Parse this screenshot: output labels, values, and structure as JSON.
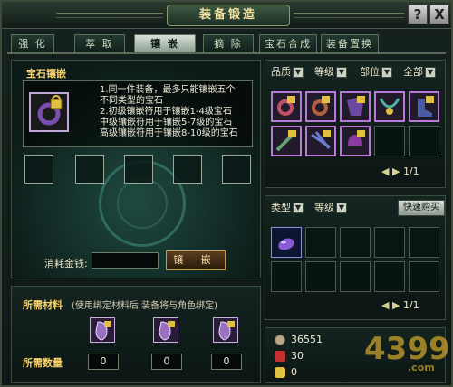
{
  "window": {
    "title": "装备锻造"
  },
  "buttons": {
    "help": "?",
    "close": "X"
  },
  "tabs": [
    "强 化",
    "萃 取",
    "镶 嵌",
    "摘 除",
    "宝石合成",
    "装备置换"
  ],
  "active_tab": 2,
  "inlay": {
    "section_title": "宝石镶嵌",
    "lines": [
      "1.同一件装备，最多只能镶嵌五个",
      "不同类型的宝石",
      "2.初级镶嵌符用于镶嵌1-4级宝石",
      "中级镶嵌符用于镶嵌5-7级的宝石",
      "高级镶嵌符用于镶嵌8-10级的宝石"
    ],
    "cost_label": "消耗金钱:",
    "cost_value": "",
    "inlay_button": "镶 嵌"
  },
  "materials": {
    "title": "所需材料",
    "note": "(使用绑定材料后,装备将与角色绑定)",
    "qty_label": "所需数量",
    "quantities": [
      "0",
      "0",
      "0"
    ]
  },
  "inventory": {
    "filters": [
      "品质",
      "等级",
      "部位",
      "全部"
    ],
    "page": "1/1"
  },
  "gems": {
    "filters": [
      "类型",
      "等级"
    ],
    "buy_button": "快速购买",
    "page": "1/1"
  },
  "currency": {
    "gold": "36551",
    "bound_gold": "30",
    "ingot": "0",
    "gold_icon": "coin-icon",
    "bound_icon": "gift-icon",
    "ingot_icon": "ingot-icon"
  },
  "watermark": {
    "text": "4399",
    "domain": ".com"
  },
  "colors": {
    "accent": "#f6d06a",
    "item_border": "#b77ad8",
    "button": "#c89c4a"
  }
}
